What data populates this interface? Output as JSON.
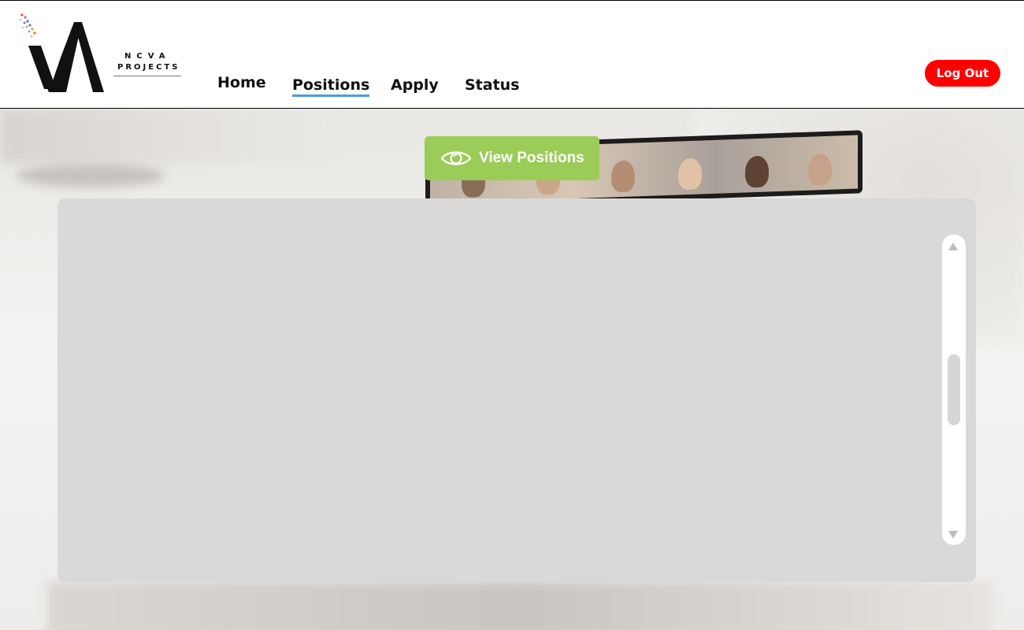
{
  "logo": {
    "line1": "NCVA",
    "line2": "PROJECTS"
  },
  "nav": {
    "home": "Home",
    "positions": "Positions",
    "apply": "Apply",
    "status": "Status",
    "active": "Positions"
  },
  "header": {
    "logout_label": "Log Out"
  },
  "main": {
    "view_positions_label": "View Positions",
    "view_positions_icon": "eye-icon"
  },
  "colors": {
    "accent_green": "#9ccc58",
    "logout_red": "#ff0000",
    "nav_underline": "#4a9be6",
    "panel": "#d9d9d9"
  }
}
